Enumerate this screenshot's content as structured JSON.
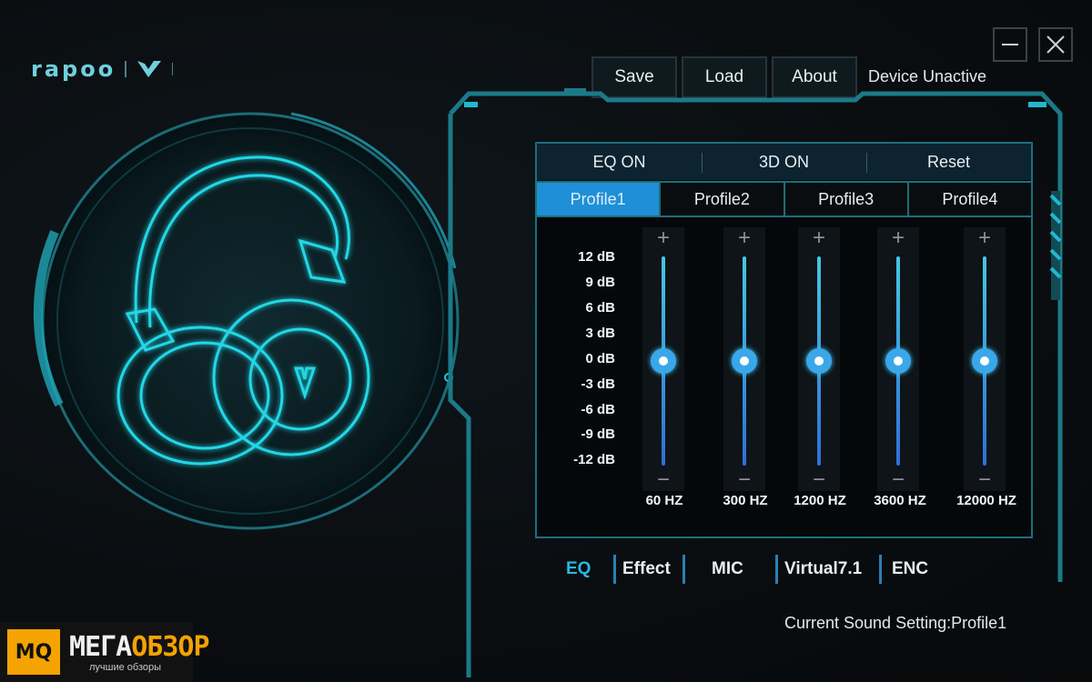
{
  "window": {
    "minimize_icon": "minimize-icon",
    "close_icon": "close-icon"
  },
  "brand": {
    "wordmark": "rapoo",
    "sub_logo": "V-logo-icon"
  },
  "toolbar": {
    "save_label": "Save",
    "load_label": "Load",
    "about_label": "About"
  },
  "device": {
    "status": "Device Unactive"
  },
  "modes": {
    "eq": "EQ ON",
    "3d": "3D ON",
    "reset": "Reset"
  },
  "profiles": [
    {
      "label": "Profile1",
      "active": true
    },
    {
      "label": "Profile2",
      "active": false
    },
    {
      "label": "Profile3",
      "active": false
    },
    {
      "label": "Profile4",
      "active": false
    }
  ],
  "db_scale": [
    "12 dB",
    "9 dB",
    "6 dB",
    "3 dB",
    "0 dB",
    "-3 dB",
    "-6 dB",
    "-9 dB",
    "-12 dB"
  ],
  "bands": [
    {
      "label": "60  HZ",
      "gain_db": 0
    },
    {
      "label": "300  HZ",
      "gain_db": 0
    },
    {
      "label": "1200  HZ",
      "gain_db": 0
    },
    {
      "label": "3600  HZ",
      "gain_db": 0
    },
    {
      "label": "12000  HZ",
      "gain_db": 0
    }
  ],
  "slider_controls": {
    "increase_symbol": "+",
    "decrease_symbol": "−"
  },
  "nav": {
    "eq": "EQ",
    "effect": "Effect",
    "mic": "MIC",
    "virtual": "Virtual7.1",
    "enc": "ENC"
  },
  "status": {
    "current_setting": "Current Sound Setting:Profile1"
  },
  "watermark": {
    "logo_text": "MQ",
    "title_a": "МЕГА",
    "title_b": "ОБЗОР",
    "subtitle": "лучшие обзоры"
  },
  "colors": {
    "accent": "#27b9e0",
    "active_tab": "#1f8fd8",
    "glow": "#21c9d9"
  }
}
